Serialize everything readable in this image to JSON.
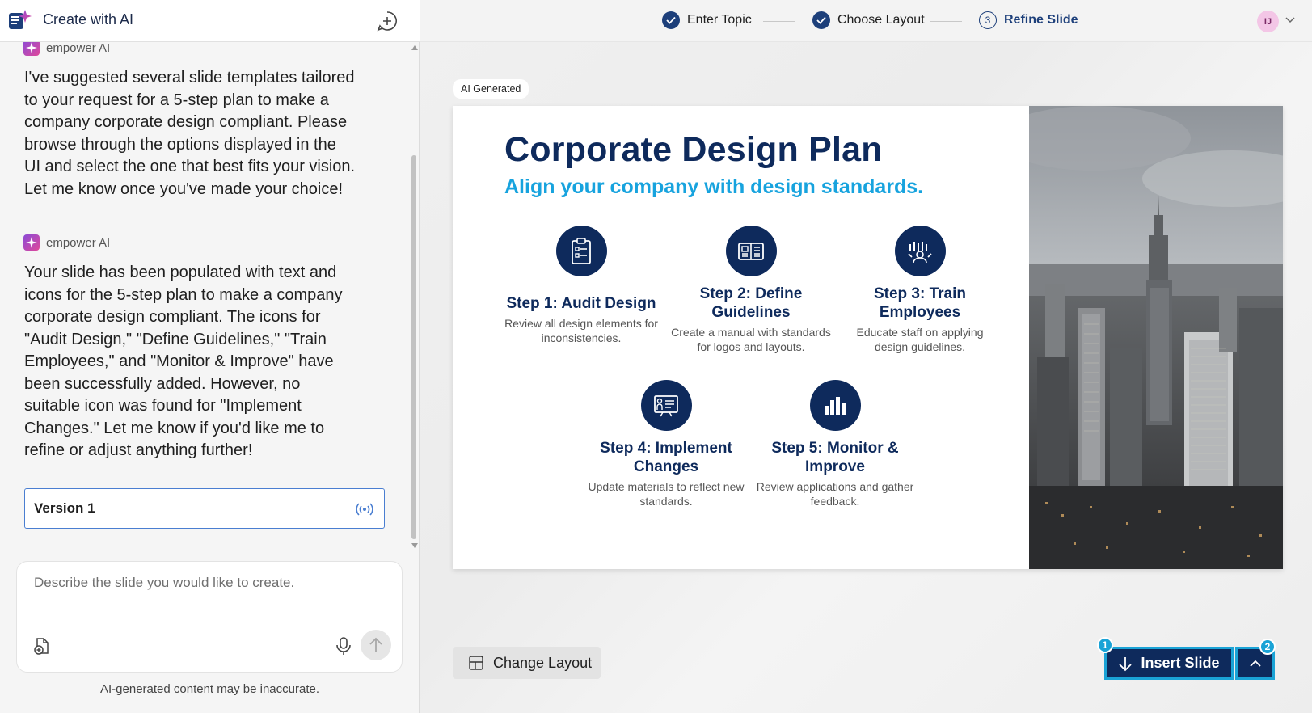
{
  "app": {
    "title": "Create with AI"
  },
  "chat": {
    "messages": [
      {
        "sender": "empower AI",
        "text": "I've suggested several slide templates tailored to your request for a 5-step plan to make a company corporate design compliant. Please browse through the options displayed in the UI and select the one that best fits your vision. Let me know once you've made your choice!"
      },
      {
        "sender": "empower AI",
        "text": "Your slide has been populated with text and icons for the 5-step plan to make a company corporate design compliant. The icons for \"Audit Design,\" \"Define Guidelines,\" \"Train Employees,\" and \"Monitor & Improve\" have been successfully added. However, no suitable icon was found for \"Implement Changes.\" Let me know if you'd like me to refine or adjust anything further!"
      }
    ],
    "version_label": "Version 1"
  },
  "composer": {
    "placeholder": "Describe the slide you would like to create."
  },
  "disclaimer": "AI-generated content may be inaccurate.",
  "stepper": {
    "steps": [
      {
        "label": "Enter Topic",
        "state": "done"
      },
      {
        "label": "Choose Layout",
        "state": "done"
      },
      {
        "label": "Refine Slide",
        "state": "active",
        "number": "3"
      }
    ]
  },
  "user": {
    "initials": "IJ"
  },
  "badge": "AI Generated",
  "slide": {
    "title": "Corporate Design Plan",
    "subtitle": "Align your company with design standards.",
    "steps": [
      {
        "title": "Step 1: Audit Design",
        "desc": "Review all design elements for inconsistencies.",
        "icon": "clipboard-icon"
      },
      {
        "title": "Step 2: Define Guidelines",
        "desc": "Create a manual with standards for logos and layouts.",
        "icon": "book-icon"
      },
      {
        "title": "Step 3: Train Employees",
        "desc": "Educate staff on applying design guidelines.",
        "icon": "team-icon"
      },
      {
        "title": "Step 4: Implement Changes",
        "desc": "Update materials to reflect new standards.",
        "icon": "presentation-icon"
      },
      {
        "title": "Step 5: Monitor & Improve",
        "desc": "Review applications and gather feedback.",
        "icon": "bar-chart-icon"
      }
    ]
  },
  "actions": {
    "change_layout": "Change Layout",
    "insert_slide": "Insert Slide",
    "marker_1": "1",
    "marker_2": "2"
  },
  "colors": {
    "navy": "#0e2a5c",
    "accent": "#17a3de",
    "highlight": "#1aa3d6"
  }
}
